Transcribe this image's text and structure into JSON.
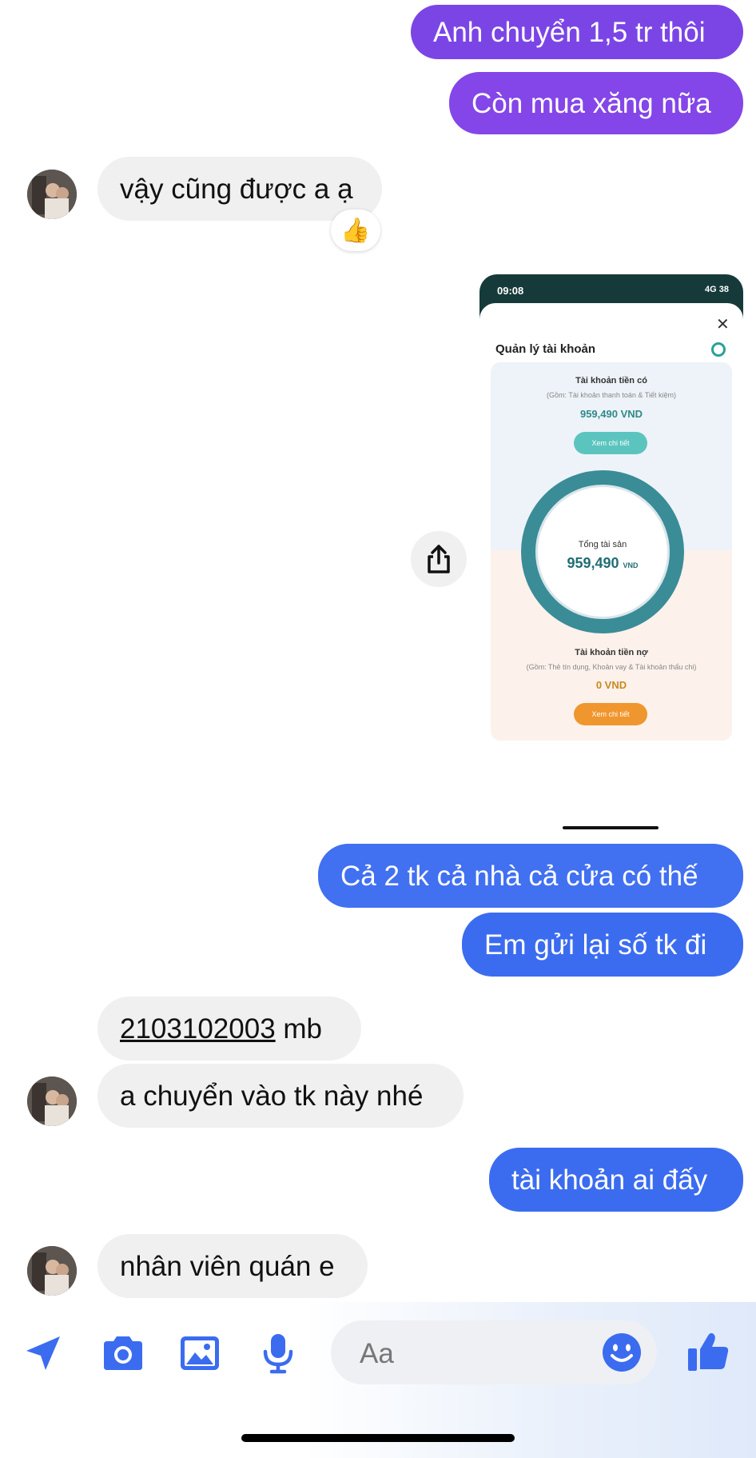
{
  "colors": {
    "outgoing_purple": "#7b45e6",
    "outgoing_blue": "#3f6ef2",
    "incoming_bg": "#f0f0f0",
    "accent": "#3b6cf0"
  },
  "messages": [
    {
      "id": "m1",
      "direction": "out",
      "text": "Anh chuyển 1,5 tr thôi"
    },
    {
      "id": "m2",
      "direction": "out",
      "text": "Còn mua xăng nữa"
    },
    {
      "id": "m3",
      "direction": "in",
      "text": "vậy cũng được a ạ",
      "reaction": "👍"
    },
    {
      "id": "m4",
      "direction": "out",
      "text": "Cả 2 tk cả nhà cả cửa có thế"
    },
    {
      "id": "m5",
      "direction": "out",
      "text": "Em gửi lại số tk đi"
    },
    {
      "id": "m6",
      "direction": "in",
      "account": "2103102003",
      "suffix": " mb"
    },
    {
      "id": "m7",
      "direction": "in",
      "text": "a chuyển vào tk này nhé"
    },
    {
      "id": "m8",
      "direction": "out",
      "text": "tài khoản ai đấy"
    },
    {
      "id": "m9",
      "direction": "in",
      "text": "nhân viên quán e"
    }
  ],
  "shared_screenshot": {
    "status_time": "09:08",
    "status_right": "4G 38",
    "title": "Quản lý tài khoản",
    "close_icon": "close-icon",
    "asset_account": {
      "heading": "Tài khoản tiền có",
      "note": "(Gồm: Tài khoản thanh toán & Tiết kiệm)",
      "value": "959,490 VND",
      "button": "Xem chi tiết"
    },
    "total": {
      "label": "Tổng tài sản",
      "value": "959,490",
      "unit": "VND"
    },
    "debt_account": {
      "heading": "Tài khoản tiền nợ",
      "note": "(Gồm: Thẻ tín dụng, Khoản vay & Tài khoản thấu chi)",
      "value": "0 VND",
      "button": "Xem chi tiết"
    }
  },
  "composer": {
    "placeholder": "Aa",
    "icons": [
      "location-icon",
      "camera-icon",
      "image-icon",
      "microphone-icon",
      "emoji-icon",
      "thumbs-up-icon"
    ]
  }
}
